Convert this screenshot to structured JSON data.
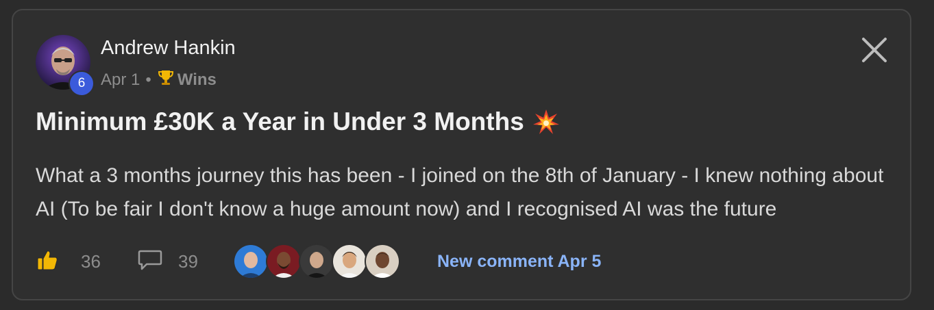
{
  "post": {
    "author": "Andrew Hankin",
    "level": "6",
    "date": "Apr 1",
    "separator": "•",
    "category_icon": "trophy-icon",
    "category": "Wins",
    "title": "Minimum £30K a Year in Under 3 Months",
    "title_icon": "collision-burst-icon",
    "body": "What a 3 months journey this has been - I joined on the 8th of January - I knew nothing about AI (To be fair I don't know a huge amount now) and I recognised AI was the future"
  },
  "footer": {
    "likes": "36",
    "like_icon": "thumbs-up-icon",
    "comments": "39",
    "comment_icon": "comment-bubble-icon",
    "commenter_avatars": 5,
    "new_comment": "New comment Apr 5"
  },
  "colors": {
    "background": "#2f2f2f",
    "link": "#8ab4f8",
    "badge": "#3b5bdb",
    "muted_text": "#8d8d8d"
  }
}
